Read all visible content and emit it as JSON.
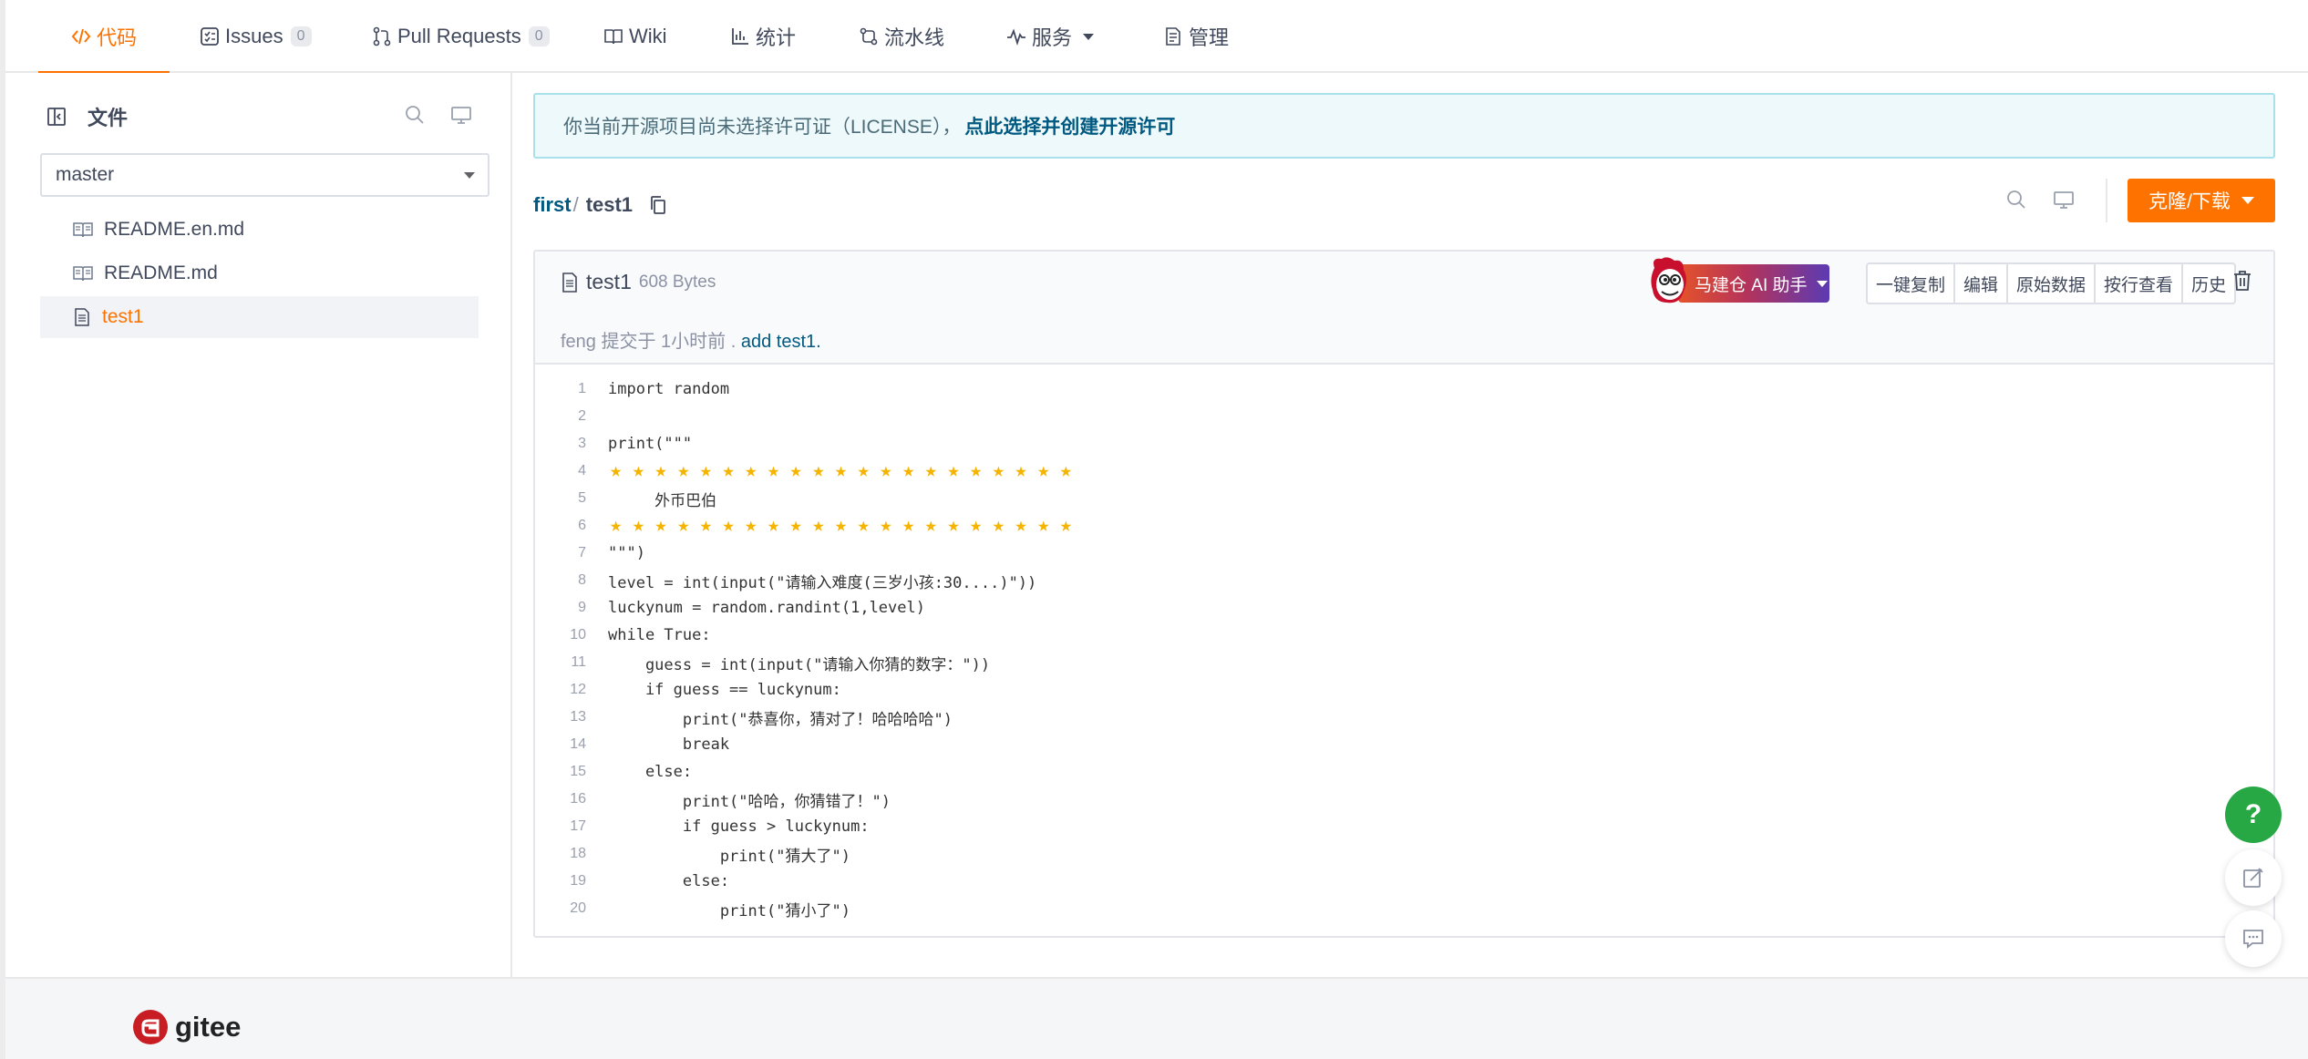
{
  "nav": {
    "tabs": [
      {
        "label": "代码",
        "icon": "code-icon",
        "active": true
      },
      {
        "label": "Issues",
        "icon": "issues-icon",
        "count": "0"
      },
      {
        "label": "Pull Requests",
        "icon": "pull-request-icon",
        "count": "0"
      },
      {
        "label": "Wiki",
        "icon": "book-icon"
      },
      {
        "label": "统计",
        "icon": "bar-chart-icon"
      },
      {
        "label": "流水线",
        "icon": "pipeline-icon"
      },
      {
        "label": "服务",
        "icon": "pulse-icon"
      },
      {
        "label": "管理",
        "icon": "document-icon"
      }
    ]
  },
  "sidebar": {
    "title": "文件",
    "branch": "master",
    "files": [
      {
        "name": "README.en.md",
        "icon": "book-icon"
      },
      {
        "name": "README.md",
        "icon": "book-icon"
      },
      {
        "name": "test1",
        "icon": "file-icon",
        "active": true
      }
    ]
  },
  "license": {
    "text": "你当前开源项目尚未选择许可证（LICENSE），",
    "link": "点此选择并创建开源许可"
  },
  "breadcrumb": {
    "repo": "first",
    "sep": "/",
    "file": "test1"
  },
  "clone_button": "克隆/下载",
  "file": {
    "name": "test1",
    "size": "608 Bytes",
    "commit_author": "feng",
    "commit_text": "提交于 1小时前 .",
    "commit_message": "add test1.",
    "ai_button": "马建仓 AI 助手",
    "actions": [
      "一键复制",
      "编辑",
      "原始数据",
      "按行查看",
      "历史"
    ]
  },
  "code_lines": [
    "import random",
    "",
    "print(\"\"\"",
    "★★★★★★★★★★★★★★★★★★★★★",
    "     外币巴伯",
    "★★★★★★★★★★★★★★★★★★★★★",
    "\"\"\")",
    "level = int(input(\"请输入难度(三岁小孩:30....)\"))",
    "luckynum = random.randint(1,level)",
    "while True:",
    "    guess = int(input(\"请输入你猜的数字：\"))",
    "    if guess == luckynum:",
    "        print(\"恭喜你，猜对了！哈哈哈哈\")",
    "        break",
    "    else:",
    "        print(\"哈哈，你猜错了！\")",
    "        if guess > luckynum:",
    "            print(\"猜大了\")",
    "        else:",
    "            print(\"猜小了\")"
  ],
  "line_numbers": [
    "1",
    "2",
    "3",
    "4",
    "5",
    "6",
    "7",
    "8",
    "9",
    "10",
    "11",
    "12",
    "13",
    "14",
    "15",
    "16",
    "17",
    "18",
    "19",
    "20"
  ],
  "floating": {
    "help": "?"
  },
  "footer": {
    "brand": "gitee"
  },
  "colors": {
    "accent": "#fe7300",
    "link": "#005980",
    "help": "#28a745"
  }
}
